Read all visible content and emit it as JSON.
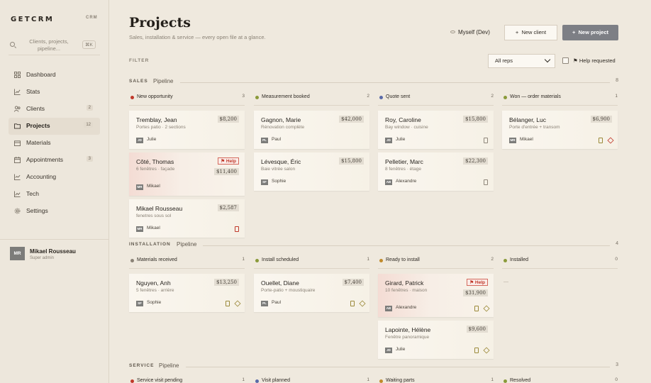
{
  "brand": {
    "name": "GETCRM",
    "tag": "CRM"
  },
  "search": {
    "placeholder": "Clients, projects, pipeline...",
    "shortcut": "⌘K"
  },
  "nav": [
    {
      "label": "Dashboard",
      "icon": "grid-icon",
      "badge": ""
    },
    {
      "label": "Stats",
      "icon": "chart-icon",
      "badge": ""
    },
    {
      "label": "Clients",
      "icon": "users-icon",
      "badge": "2"
    },
    {
      "label": "Projects",
      "icon": "folder-icon",
      "badge": "12",
      "active": true
    },
    {
      "label": "Materials",
      "icon": "box-icon",
      "badge": ""
    },
    {
      "label": "Appointments",
      "icon": "calendar-icon",
      "badge": "3"
    },
    {
      "label": "Accounting",
      "icon": "ledger-icon",
      "badge": ""
    },
    {
      "label": "Tech",
      "icon": "chart-icon",
      "badge": ""
    },
    {
      "label": "Settings",
      "icon": "gear-icon",
      "badge": ""
    }
  ],
  "user": {
    "initials": "MR",
    "name": "Mikael Rousseau",
    "role": "Super admin"
  },
  "header": {
    "title": "Projects",
    "subtitle": "Sales, installation & service — every open file at a glance.",
    "myself": "Myself (Dev)",
    "new_client": "New client",
    "new_project": "New project"
  },
  "filter": {
    "label": "FILTER",
    "select_value": "All reps",
    "help_label": "Help requested"
  },
  "sections": {
    "sales": {
      "name": "SALES",
      "pipeline": "Pipeline",
      "count": "8",
      "columns": [
        {
          "label": "New opportunity",
          "count": "3",
          "color": "#c0392b",
          "cards": [
            {
              "name": "Tremblay, Jean",
              "desc": "Portes patio · 2 sections",
              "amount": "$8,200",
              "rep_initials": "JD",
              "rep": "Julie"
            },
            {
              "name": "Côté, Thomas",
              "desc": "6 fenêtres · façade",
              "amount": "$11,400",
              "help": "Help",
              "rep_initials": "MR",
              "rep": "Mikael"
            },
            {
              "name": "Mikael Rousseau",
              "desc": "fenetres sous sol",
              "amount": "$2,587",
              "rep_initials": "MR",
              "rep": "Mikael"
            }
          ]
        },
        {
          "label": "Measurement booked",
          "count": "2",
          "color": "#8a9a3a",
          "cards": [
            {
              "name": "Gagnon, Marie",
              "desc": "Rénovation complète",
              "amount": "$42,000",
              "rep_initials": "PL",
              "rep": "Paul"
            },
            {
              "name": "Lévesque, Éric",
              "desc": "Baie vitrée salon",
              "amount": "$15,800",
              "rep_initials": "SF",
              "rep": "Sophie"
            }
          ]
        },
        {
          "label": "Quote sent",
          "count": "2",
          "color": "#5a6aa8",
          "cards": [
            {
              "name": "Roy, Caroline",
              "desc": "Bay window · cuisine",
              "amount": "$15,800",
              "rep_initials": "JD",
              "rep": "Julie"
            },
            {
              "name": "Pelletier, Marc",
              "desc": "8 fenêtres · étage",
              "amount": "$22,300",
              "rep_initials": "AB",
              "rep": "Alexandre"
            }
          ]
        },
        {
          "label": "Won — order materials",
          "count": "1",
          "color": "#8a9a3a",
          "cards": [
            {
              "name": "Bélanger, Luc",
              "desc": "Porte d'entrée + transom",
              "amount": "$6,900",
              "rep_initials": "MR",
              "rep": "Mikael"
            }
          ]
        }
      ]
    },
    "installation": {
      "name": "INSTALLATION",
      "pipeline": "Pipeline",
      "count": "4",
      "columns": [
        {
          "label": "Materials received",
          "count": "1",
          "color": "#8a8276",
          "cards": [
            {
              "name": "Nguyen, Anh",
              "desc": "5 fenêtres · arrière",
              "amount": "$13,250",
              "rep_initials": "SF",
              "rep": "Sophie"
            }
          ]
        },
        {
          "label": "Install scheduled",
          "count": "1",
          "color": "#8a9a3a",
          "cards": [
            {
              "name": "Ouellet, Diane",
              "desc": "Porte-patio + moustiquaire",
              "amount": "$7,400",
              "rep_initials": "PL",
              "rep": "Paul"
            }
          ]
        },
        {
          "label": "Ready to install",
          "count": "2",
          "color": "#c08a2b",
          "cards": [
            {
              "name": "Girard, Patrick",
              "desc": "10 fenêtres · maison",
              "amount": "$31,900",
              "help": "Help",
              "rep_initials": "AB",
              "rep": "Alexandre"
            },
            {
              "name": "Lapointe, Hélène",
              "desc": "Fenêtre panoramique",
              "amount": "$9,600",
              "rep_initials": "JD",
              "rep": "Julie"
            }
          ]
        },
        {
          "label": "Installed",
          "count": "0",
          "color": "#8a9a3a",
          "empty": "—",
          "cards": []
        }
      ]
    },
    "service": {
      "name": "SERVICE",
      "pipeline": "Pipeline",
      "count": "3",
      "columns": [
        {
          "label": "Service visit pending",
          "count": "1",
          "color": "#c0392b"
        },
        {
          "label": "Visit planned",
          "count": "1",
          "color": "#5a6aa8"
        },
        {
          "label": "Waiting parts",
          "count": "1",
          "color": "#c08a2b"
        },
        {
          "label": "Resolved",
          "count": "0",
          "color": "#8a9a3a"
        }
      ]
    }
  }
}
